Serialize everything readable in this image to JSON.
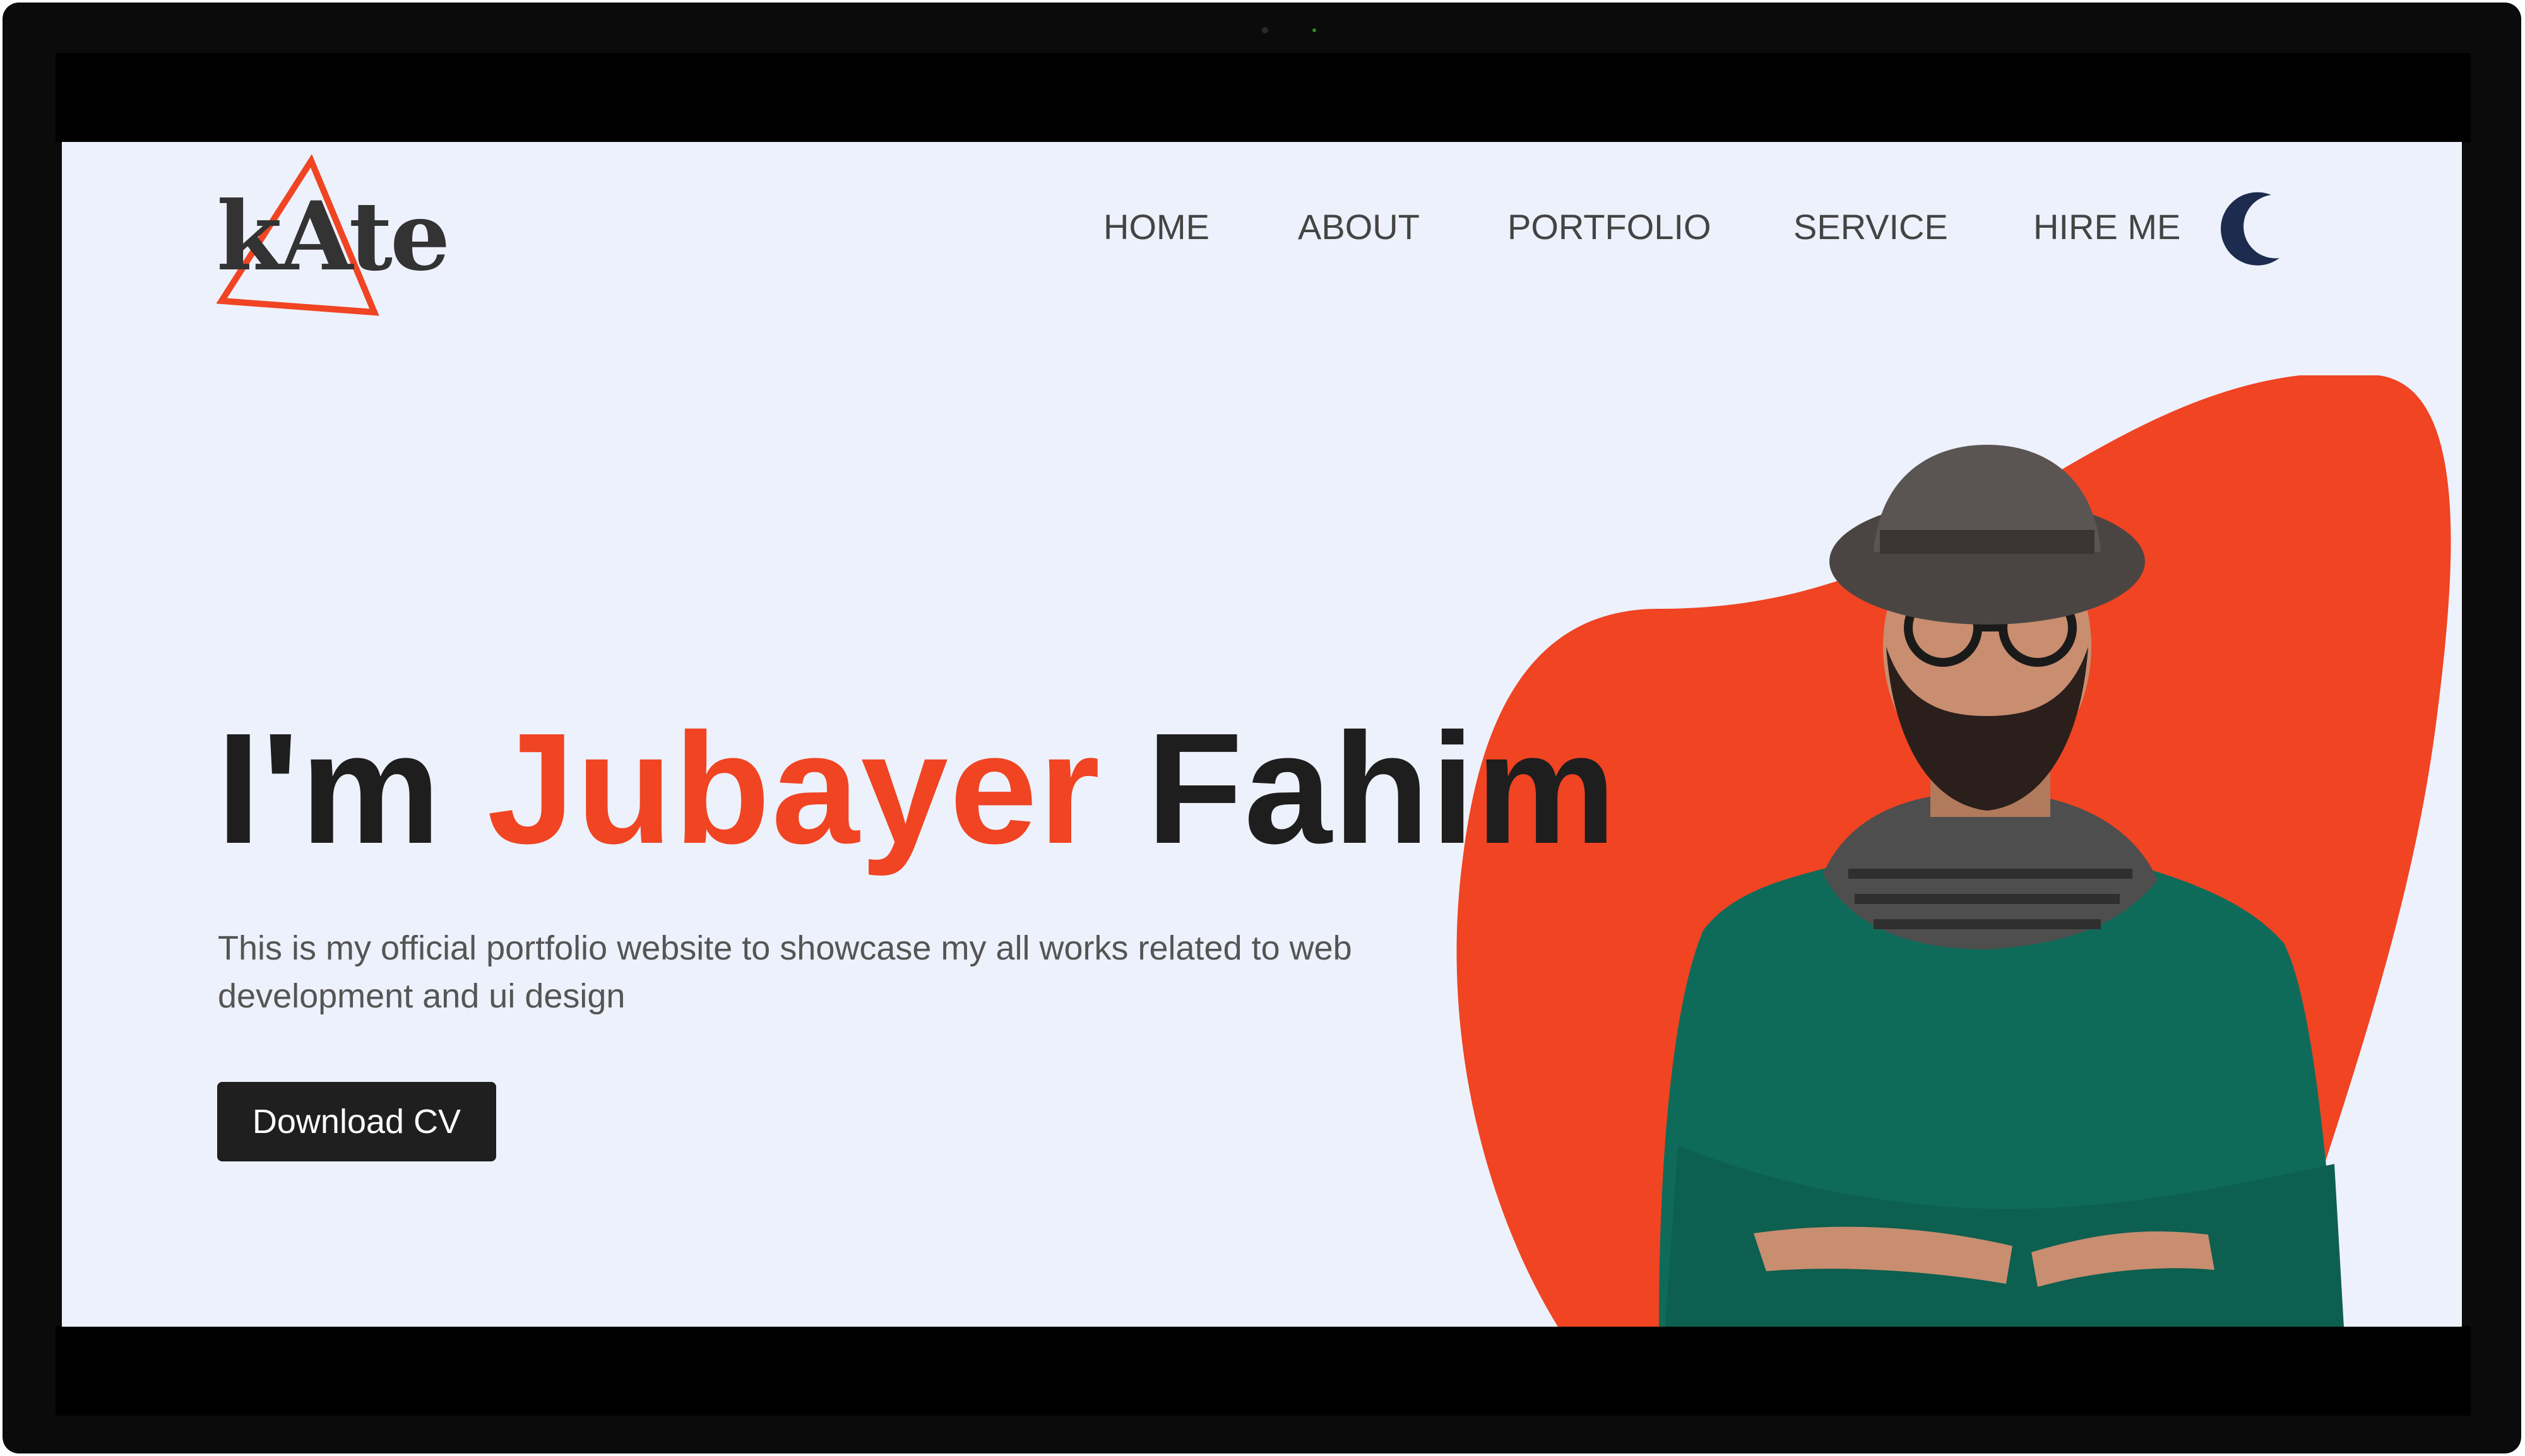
{
  "brand": {
    "logo_text": "kAte"
  },
  "nav": {
    "items": [
      {
        "label": "HOME"
      },
      {
        "label": "ABOUT"
      },
      {
        "label": "PORTFOLIO"
      },
      {
        "label": "SERVICE"
      },
      {
        "label": "HIRE ME"
      }
    ],
    "theme_toggle_icon": "moon-icon"
  },
  "hero": {
    "greeting": "I'm",
    "first_name": "Jubayer",
    "last_name": "Fahim",
    "description": "This is my official portfolio website to showcase my all works related to web development and ui design",
    "cta_label": "Download CV"
  },
  "colors": {
    "accent": "#f04423",
    "background": "#edf1fb",
    "text_dark": "#1e1e1e",
    "moon": "#1d2b4f"
  }
}
